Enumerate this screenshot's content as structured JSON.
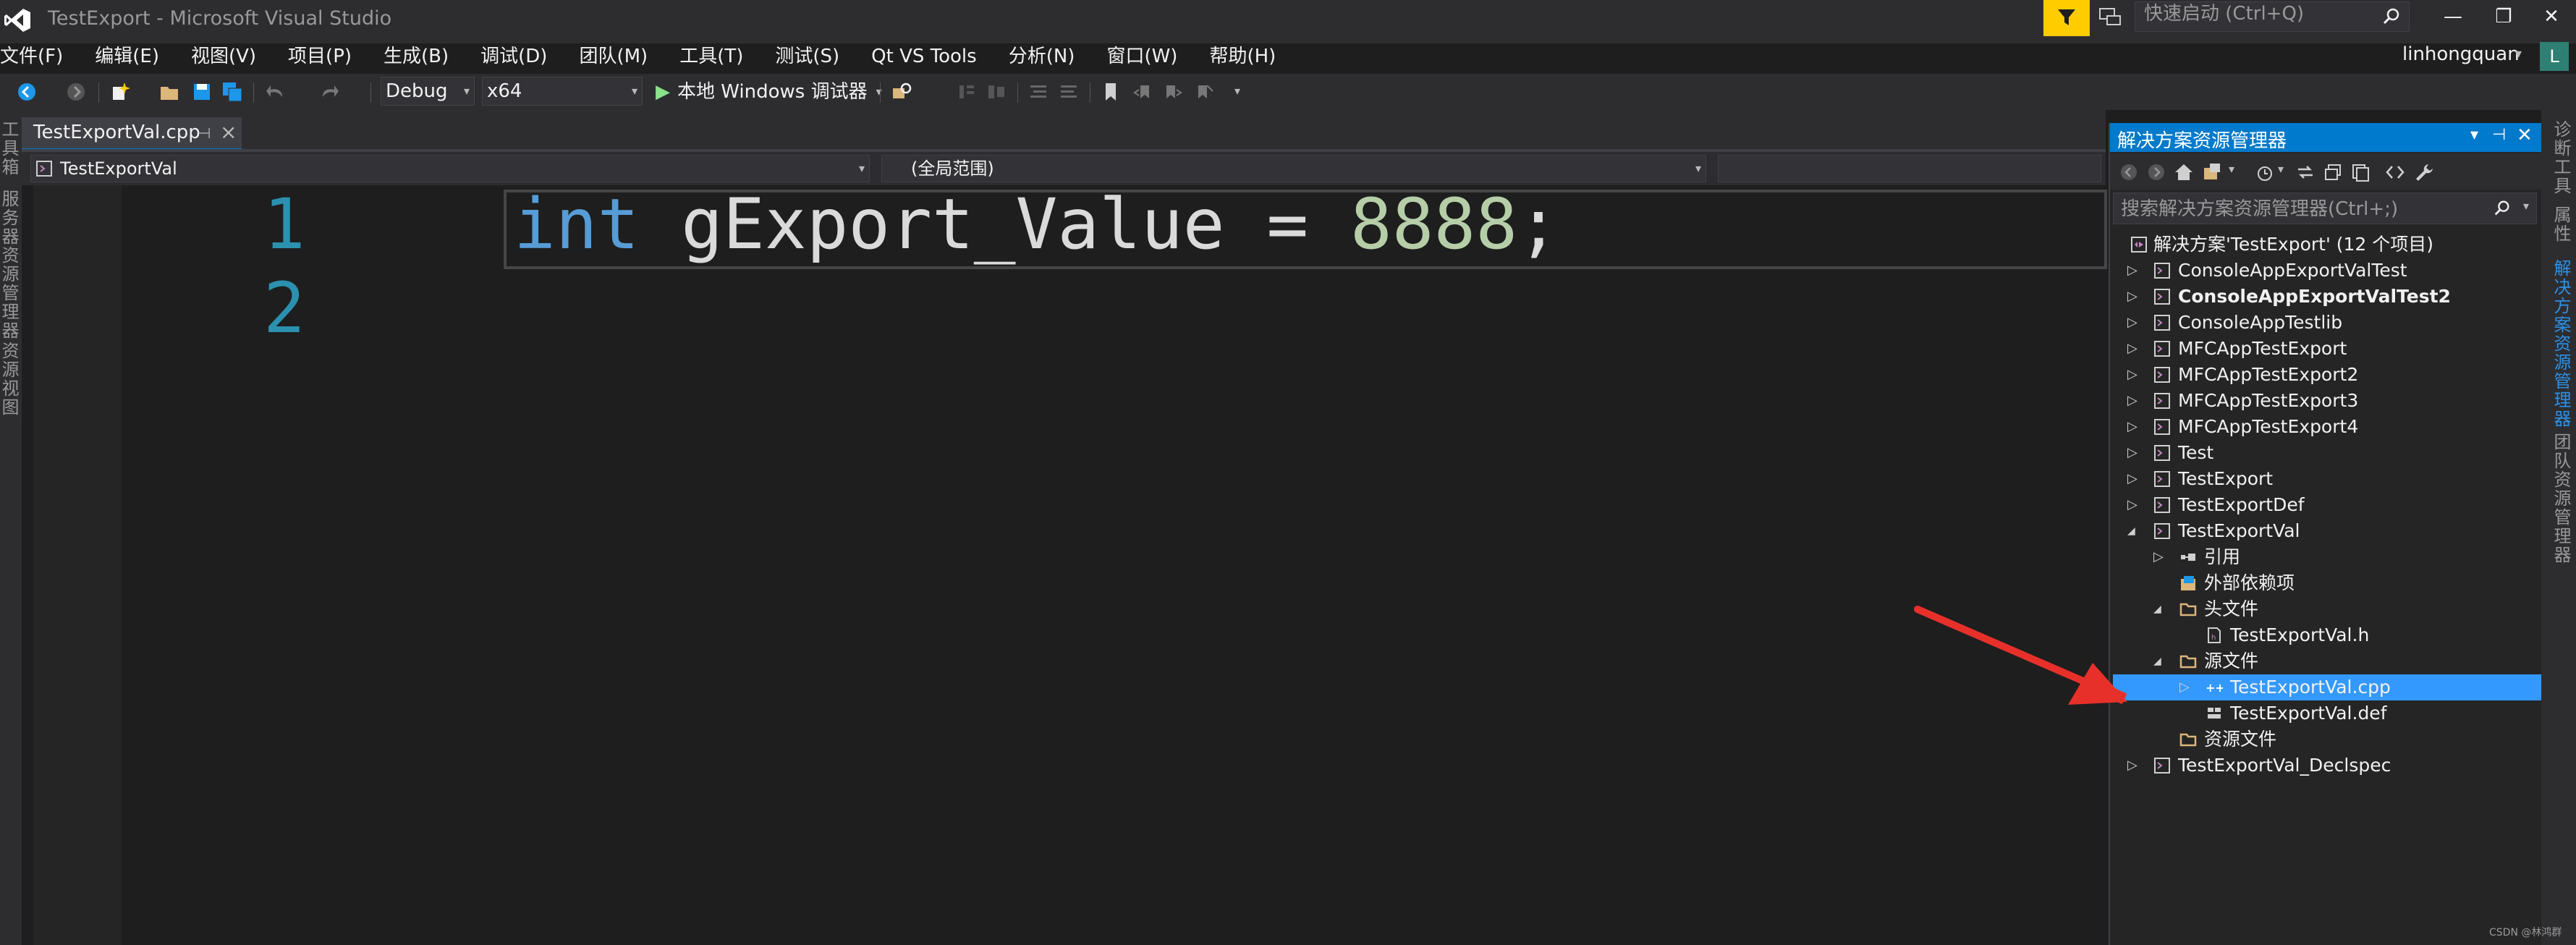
{
  "window": {
    "title": "TestExport - Microsoft Visual Studio",
    "quick_launch_placeholder": "快速启动 (Ctrl+Q)",
    "minimize": "—",
    "restore": "❐",
    "close": "✕"
  },
  "menu": {
    "items": [
      "文件(F)",
      "编辑(E)",
      "视图(V)",
      "项目(P)",
      "生成(B)",
      "调试(D)",
      "团队(M)",
      "工具(T)",
      "测试(S)",
      "Qt VS Tools",
      "分析(N)",
      "窗口(W)",
      "帮助(H)"
    ],
    "user": "linhongquan",
    "user_initial": "L"
  },
  "toolbar": {
    "config": "Debug",
    "platform": "x64",
    "run_label": "本地 Windows 调试器"
  },
  "left_strip": {
    "tabs": [
      "工具箱",
      "服务器资源管理器",
      "资源视图"
    ]
  },
  "editor": {
    "tab_label": "TestExportVal.cpp",
    "nav_project": "TestExportVal",
    "nav_scope": "(全局范围)",
    "line_numbers": [
      "1",
      "2"
    ],
    "code": {
      "keyword": "int",
      "identifier": " gExport_Value = ",
      "number": "8888",
      "terminator": ";"
    }
  },
  "solution_explorer": {
    "title": "解决方案资源管理器",
    "search_placeholder": "搜索解决方案资源管理器(Ctrl+;)",
    "items": [
      {
        "label": "解决方案'TestExport' (12 个项目)",
        "arrow": ""
      },
      {
        "label": "ConsoleAppExportValTest",
        "arrow": "▷"
      },
      {
        "label": "ConsoleAppExportValTest2",
        "arrow": "▷"
      },
      {
        "label": "ConsoleAppTestlib",
        "arrow": "▷"
      },
      {
        "label": "MFCAppTestExport",
        "arrow": "▷"
      },
      {
        "label": "MFCAppTestExport2",
        "arrow": "▷"
      },
      {
        "label": "MFCAppTestExport3",
        "arrow": "▷"
      },
      {
        "label": "MFCAppTestExport4",
        "arrow": "▷"
      },
      {
        "label": "Test",
        "arrow": "▷"
      },
      {
        "label": "TestExport",
        "arrow": "▷"
      },
      {
        "label": "TestExportDef",
        "arrow": "▷"
      },
      {
        "label": "TestExportVal",
        "arrow": "◢"
      },
      {
        "label": "引用",
        "arrow": "▷"
      },
      {
        "label": "外部依赖项",
        "arrow": ""
      },
      {
        "label": "头文件",
        "arrow": "◢"
      },
      {
        "label": "TestExportVal.h",
        "arrow": ""
      },
      {
        "label": "源文件",
        "arrow": "◢"
      },
      {
        "label": "TestExportVal.cpp",
        "arrow": "▷"
      },
      {
        "label": "TestExportVal.def",
        "arrow": ""
      },
      {
        "label": "资源文件",
        "arrow": ""
      },
      {
        "label": "TestExportVal_Declspec",
        "arrow": "▷"
      }
    ]
  },
  "right_strip": {
    "tabs": [
      "诊断工具",
      "属性",
      "解决方案资源管理器",
      "团队资源管理器"
    ]
  },
  "watermark": "CSDN @林鸿群",
  "colors": {
    "accent": "#007acc",
    "selection": "#3399ff",
    "keyword": "#569cd6",
    "number": "#b5cea8",
    "line_number": "#2b91af",
    "arrow_annotation": "#e8302a"
  }
}
